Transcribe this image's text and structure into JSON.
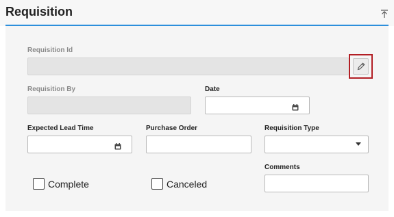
{
  "header": {
    "title": "Requisition"
  },
  "form": {
    "requisition_id": {
      "label": "Requisition Id",
      "value": ""
    },
    "requisition_by": {
      "label": "Requisition By",
      "value": ""
    },
    "date": {
      "label": "Date",
      "value": ""
    },
    "expected_lead_time": {
      "label": "Expected Lead Time",
      "value": ""
    },
    "purchase_order": {
      "label": "Purchase Order",
      "value": ""
    },
    "requisition_type": {
      "label": "Requisition Type",
      "selected": ""
    },
    "comments": {
      "label": "Comments",
      "value": ""
    },
    "complete": {
      "label": "Complete",
      "checked": false
    },
    "canceled": {
      "label": "Canceled",
      "checked": false
    }
  },
  "icons": {
    "collapse": "collapse-up-icon",
    "edit": "pencil-icon",
    "calendar": "calendar-icon",
    "dropdown": "chevron-down-icon"
  },
  "colors": {
    "accent": "#2d8fdc",
    "highlight": "#b21e24"
  }
}
